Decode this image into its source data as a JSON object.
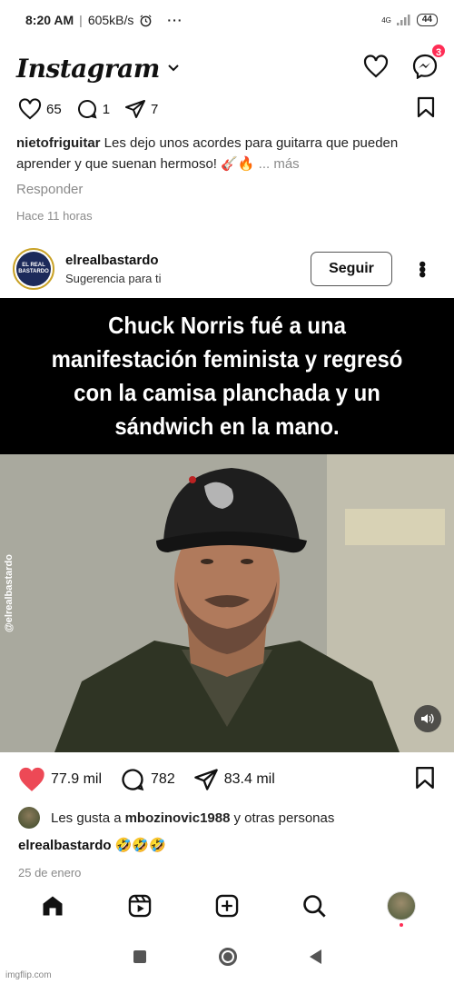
{
  "status_bar": {
    "time": "8:20 AM",
    "separator": "|",
    "speed": "605kB/s",
    "network": "4G",
    "battery": "44"
  },
  "header": {
    "logo": "Instagram",
    "messenger_badge": "3"
  },
  "prev_post": {
    "likes": "65",
    "comments": "1",
    "shares": "7",
    "caption_user": "nietofriguitar",
    "caption_text": "Les dejo unos acordes para guitarra que pueden aprender y  que suenan hermoso! 🎸🔥",
    "caption_more": "... más",
    "reply": "Responder",
    "time": "Hace 11 horas"
  },
  "post": {
    "username": "elrealbastardo",
    "subtitle": "Sugerencia para ti",
    "follow_label": "Seguir",
    "avatar_text": "EL REAL BASTARDO",
    "meme_text": "Chuck Norris fué a una manifestación feminista y regresó con la camisa planchada y un sándwich en la mano.",
    "watermark": "@elrealbastardo",
    "likes": "77.9 mil",
    "comments": "782",
    "shares": "83.4 mil",
    "likes_prefix": "Les gusta a",
    "likes_user": "mbozinovic1988",
    "likes_suffix": "y otras personas",
    "caption_user": "elrealbastardo",
    "caption_text": "🤣🤣🤣",
    "date": "25 de enero"
  },
  "footer": {
    "imgflip": "imgflip.com"
  },
  "colors": {
    "like_red": "#ed4956",
    "badge_red": "#ff2d55"
  }
}
